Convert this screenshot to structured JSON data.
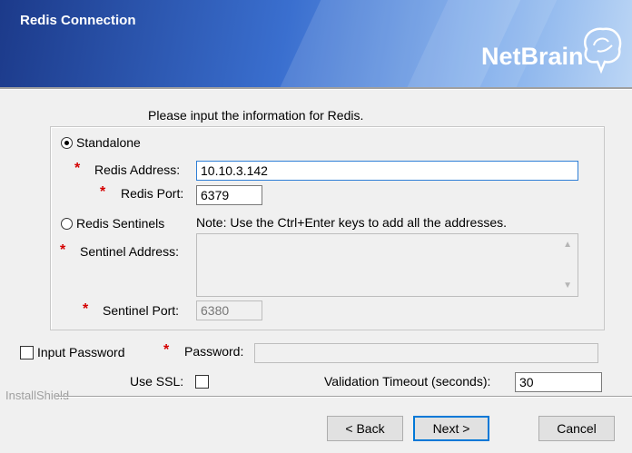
{
  "header": {
    "title": "Redis Connection",
    "brand": "NetBrain",
    "brand_color": "#ffffff",
    "gradient_start": "#1c3a8a",
    "gradient_end": "#bcd6f5"
  },
  "prompt": "Please input the information for Redis.",
  "mode": {
    "standalone_label": "Standalone",
    "standalone_selected": true,
    "sentinels_label": "Redis Sentinels",
    "sentinels_selected": false
  },
  "standalone": {
    "address_label": "Redis Address:",
    "address_value": "10.10.3.142",
    "port_label": "Redis Port:",
    "port_value": "6379"
  },
  "sentinel": {
    "note": "Note: Use the Ctrl+Enter keys to add all the addresses.",
    "address_label": "Sentinel Address:",
    "address_value": "",
    "port_label": "Sentinel Port:",
    "port_value": "6380"
  },
  "password": {
    "checkbox_label": "Input Password",
    "label": "Password:",
    "value": ""
  },
  "ssl": {
    "label": "Use SSL:",
    "checked": false
  },
  "timeout": {
    "label": "Validation Timeout (seconds):",
    "value": "30"
  },
  "required_marker": "*",
  "footer": {
    "installshield": "InstallShield",
    "back": "< Back",
    "next": "Next >",
    "cancel": "Cancel"
  }
}
